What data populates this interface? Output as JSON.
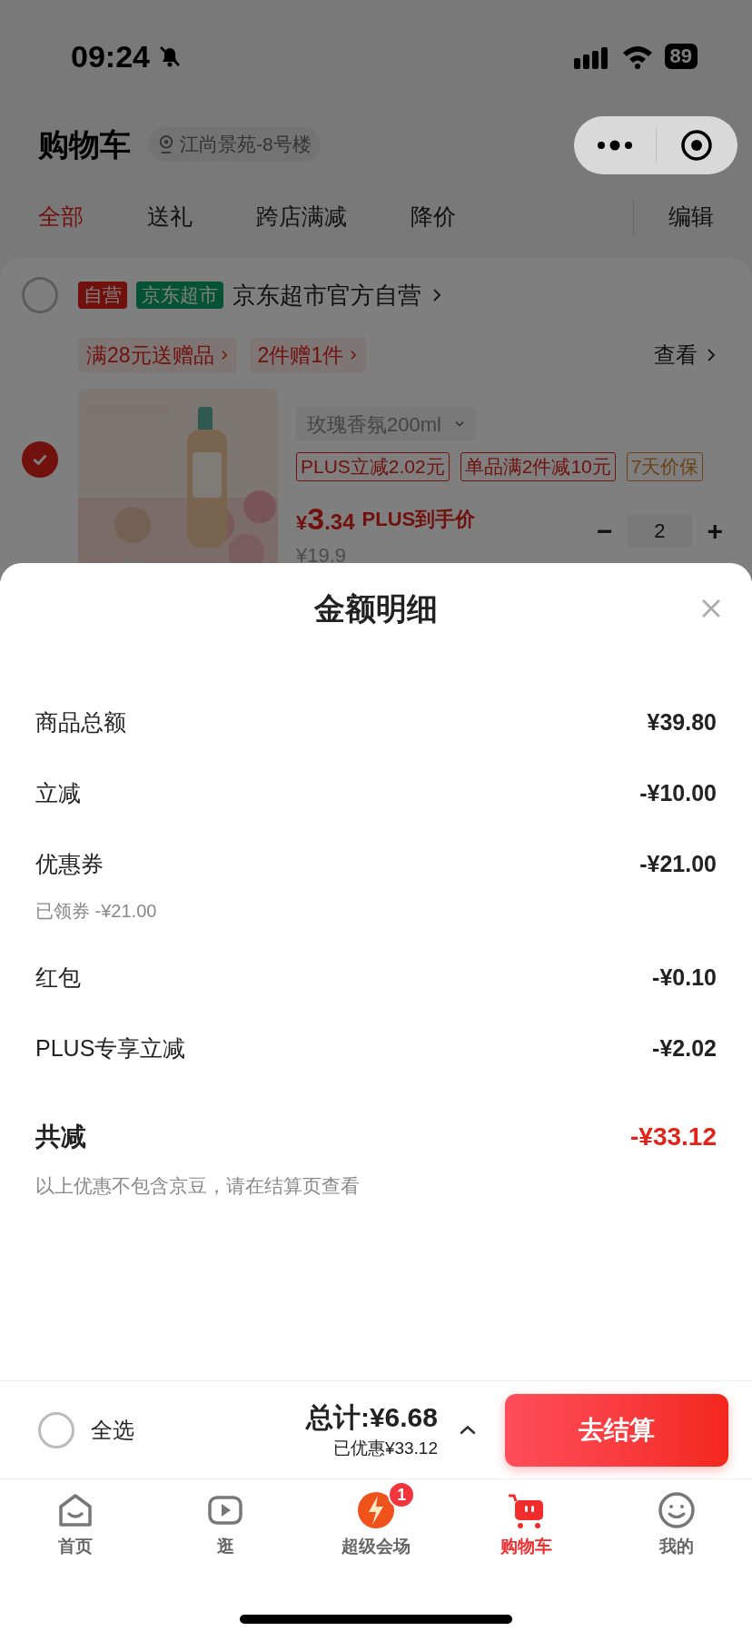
{
  "status_bar": {
    "time": "09:24",
    "battery": "89"
  },
  "header": {
    "title": "购物车",
    "location": "江尚景苑-8号楼"
  },
  "tabs": [
    {
      "label": "全部",
      "selected": true
    },
    {
      "label": "送礼",
      "selected": false
    },
    {
      "label": "跨店满减",
      "selected": false
    },
    {
      "label": "降价",
      "selected": false
    }
  ],
  "edit": "编辑",
  "store": {
    "checked": false,
    "badges": [
      {
        "text": "自营",
        "kind": "self"
      },
      {
        "text": "京东超市",
        "kind": "market"
      }
    ],
    "name": "京东超市官方自营",
    "promos": [
      "满28元送赠品",
      "2件赠1件"
    ],
    "view": "查看"
  },
  "product": {
    "checked": true,
    "variant": "玫瑰香氛200ml",
    "tags": [
      {
        "text": "PLUS立减2.02元",
        "kind": "discount"
      },
      {
        "text": "单品满2件减10元",
        "kind": "discount"
      },
      {
        "text": "7天价保",
        "kind": "guarantee"
      }
    ],
    "price_symbol": "¥",
    "price_int": "3",
    "price_dec": ".34",
    "price_label": "PLUS到手价",
    "original_price": "¥19.9",
    "minus": "−",
    "quantity": "2",
    "plus": "+"
  },
  "sheet": {
    "title": "金额明细",
    "rows": [
      {
        "label": "商品总额",
        "value": "¥39.80"
      },
      {
        "label": "立减",
        "value": "-¥10.00"
      },
      {
        "label": "优惠券",
        "value": "-¥21.00",
        "note": "已领券 -¥21.00"
      },
      {
        "label": "红包",
        "value": "-¥0.10"
      },
      {
        "label": "PLUS专享立减",
        "value": "-¥2.02"
      }
    ],
    "total": {
      "label": "共减",
      "value": "-¥33.12"
    },
    "note": "以上优惠不包含京豆，请在结算页查看"
  },
  "footer": {
    "select_all": {
      "label": "全选",
      "checked": false
    },
    "total": "总计:¥6.68",
    "saved": "已优惠¥33.12",
    "checkout": "去结算"
  },
  "nav": [
    {
      "label": "首页",
      "selected": false
    },
    {
      "label": "逛",
      "selected": false
    },
    {
      "label": "超级会场",
      "selected": false,
      "badge": "1"
    },
    {
      "label": "购物车",
      "selected": true
    },
    {
      "label": "我的",
      "selected": false
    }
  ]
}
